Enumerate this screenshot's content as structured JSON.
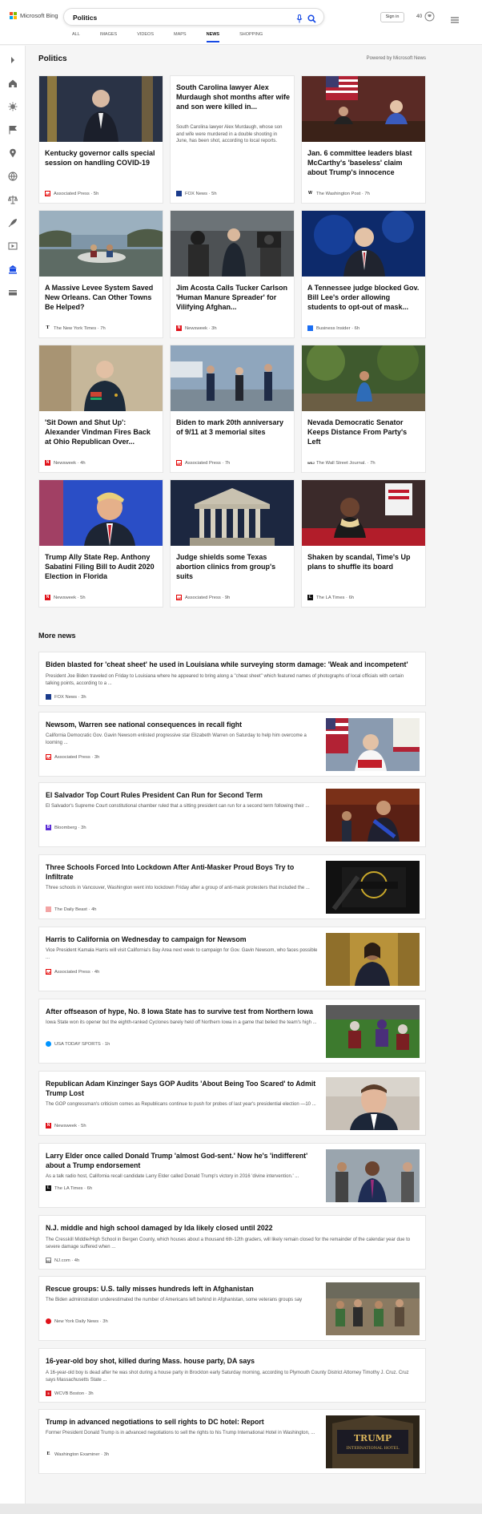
{
  "header": {
    "logo_text": "Microsoft Bing",
    "search_value": "Politics",
    "signin_label": "Sign in",
    "rewards_count": "40",
    "tabs": [
      {
        "label": "ALL"
      },
      {
        "label": "IMAGES"
      },
      {
        "label": "VIDEOS"
      },
      {
        "label": "MAPS"
      },
      {
        "label": "NEWS"
      },
      {
        "label": "SHOPPING"
      }
    ]
  },
  "section": {
    "title": "Politics",
    "powered_by": "Powered by Microsoft News"
  },
  "cards": [
    {
      "title": "Kentucky governor calls special session on handling COVID-19",
      "source": "Associated Press · 5h"
    },
    {
      "title": "South Carolina lawyer Alex Murdaugh shot months after wife and son were killed in...",
      "snippet": "South Carolina lawyer Alex Murdaugh, whose son and wife were murdered in a double shooting in June, has been shot, according to local reports.",
      "source": "FOX News · 5h"
    },
    {
      "title": "Jan. 6 committee leaders blast McCarthy's 'baseless' claim about Trump's innocence",
      "source": "The Washington Post · 7h"
    },
    {
      "title": "A Massive Levee System Saved New Orleans. Can Other Towns Be Helped?",
      "source": "The New York Times · 7h"
    },
    {
      "title": "Jim Acosta Calls Tucker Carlson 'Human Manure Spreader' for Vilifying Afghan...",
      "source": "Newsweek · 3h"
    },
    {
      "title": "A Tennessee judge blocked Gov. Bill Lee's order allowing students to opt-out of mask...",
      "source": "Business Insider · 6h"
    },
    {
      "title": "'Sit Down and Shut Up': Alexander Vindman Fires Back at Ohio Republican Over...",
      "source": "Newsweek · 4h"
    },
    {
      "title": "Biden to mark 20th anniversary of 9/11 at 3 memorial sites",
      "source": "Associated Press · 7h"
    },
    {
      "title": "Nevada Democratic Senator Keeps Distance From Party's Left",
      "source": "The Wall Street Journal. · 7h"
    },
    {
      "title": "Trump Ally State Rep. Anthony Sabatini Filing Bill to Audit 2020 Election in Florida",
      "source": "Newsweek · 5h"
    },
    {
      "title": "Judge shields some Texas abortion clinics from group's suits",
      "source": "Associated Press · 9h"
    },
    {
      "title": "Shaken by scandal, Time's Up plans to shuffle its board",
      "source": "The LA Times · 6h"
    }
  ],
  "more_news": {
    "title": "More news",
    "items": [
      {
        "title": "Biden blasted for 'cheat sheet' he used in Louisiana while surveying storm damage: 'Weak and incompetent'",
        "snippet": "President Joe Biden traveled on Friday to Louisiana where he appeared to bring along a \"cheat sheet\" which featured names of photographs of local officials with certain talking points, according to a ...",
        "source": "FOX News · 3h"
      },
      {
        "title": "Newsom, Warren see national consequences in recall fight",
        "snippet": "California Democratic Gov. Gavin Newsom enlisted progressive star Elizabeth Warren on Saturday to help him overcome a looming ...",
        "source": "Associated Press · 3h"
      },
      {
        "title": "El Salvador Top Court Rules President Can Run for Second Term",
        "snippet": "El Salvador's Supreme Court constitutional chamber ruled that a sitting president can run for a second term following their ...",
        "source": "Bloomberg · 3h"
      },
      {
        "title": "Three Schools Forced Into Lockdown After Anti-Masker Proud Boys Try to Infiltrate",
        "snippet": "Three schools in Vancouver, Washington went into lockdown Friday after a group of anti-mask protesters that included the ...",
        "source": "The Daily Beast · 4h"
      },
      {
        "title": "Harris to California on Wednesday to campaign for Newsom",
        "snippet": "Vice President Kamala Harris will visit California's Bay Area next week to campaign for Gov. Gavin Newsom, who faces possible ...",
        "source": "Associated Press · 4h"
      },
      {
        "title": "After offseason of hype, No. 8 Iowa State has to survive test from Northern Iowa",
        "snippet": "Iowa State won its opener but the eighth-ranked Cyclones barely held off Northern Iowa in a game that belied the team's high ...",
        "source": "USA TODAY SPORTS · 1h"
      },
      {
        "title": "Republican Adam Kinzinger Says GOP Audits 'About Being Too Scared' to Admit Trump Lost",
        "snippet": "The GOP congressman's criticism comes as Republicans continue to push for probes of last year's presidential election —10 ...",
        "source": "Newsweek · 5h"
      },
      {
        "title": "Larry Elder once called Donald Trump 'almost God-sent.' Now he's 'indifferent' about a Trump endorsement",
        "snippet": "As a talk radio host, California recall candidate Larry Elder called Donald Trump's victory in 2016 'divine intervention.' ...",
        "source": "The LA Times · 6h"
      },
      {
        "title": "N.J. middle and high school damaged by Ida likely closed until 2022",
        "snippet": "The Cresskill Middle/High School in Bergen County, which houses about a thousand 6th-12th graders, will likely remain closed for the remainder of the calendar year due to severe damage suffered when ...",
        "source": "NJ.com · 4h"
      },
      {
        "title": "Rescue groups: U.S. tally misses hundreds left in Afghanistan",
        "snippet": "The Biden administration underestimated the number of Americans left behind in Afghanistan, some veterans groups say",
        "source": "New York Daily News · 3h"
      },
      {
        "title": "16-year-old boy shot, killed during Mass. house party, DA says",
        "snippet": "A 16-year-old boy is dead after he was shot during a house party in Brockton early Saturday morning, according to Plymouth County District Attorney Timothy J. Cruz. Cruz says Massachusetts State ...",
        "source": "WCVB Boston · 3h"
      },
      {
        "title": "Trump in advanced negotiations to sell rights to DC hotel: Report",
        "snippet": "Former President Donald Trump is in advanced negotiations to sell the rights to his Trump International Hotel in Washington, ...",
        "source": "Washington Examiner · 3h",
        "image_text_1": "TRUMP",
        "image_text_2": "INTERNATIONAL HOTEL"
      }
    ]
  },
  "colors": {
    "accent": "#174ae4",
    "logo": [
      "#f25022",
      "#7fba00",
      "#00a4ef",
      "#ffb900"
    ]
  }
}
